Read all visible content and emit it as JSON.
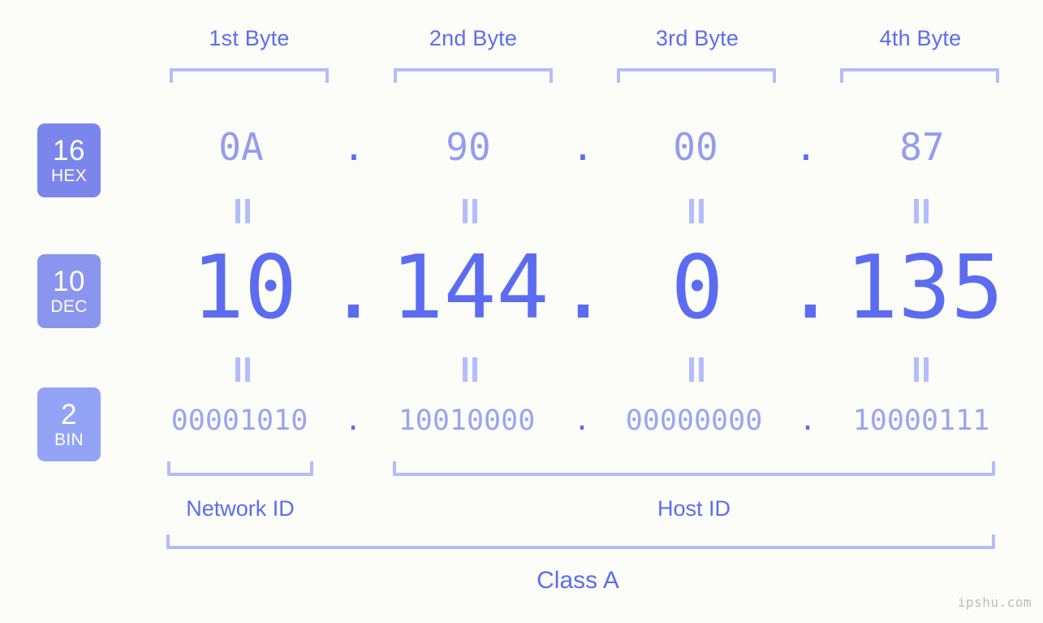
{
  "background_color": "#fcfdf9",
  "accent_color": "#5c6cf0",
  "accent_light": "#929dee",
  "bracket_color": "#b3bdfb",
  "headers": [
    {
      "label": "1st Byte"
    },
    {
      "label": "2nd Byte"
    },
    {
      "label": "3rd Byte"
    },
    {
      "label": "4th Byte"
    }
  ],
  "bases": [
    {
      "num": "16",
      "label": "HEX",
      "color": "#7b86ec"
    },
    {
      "num": "10",
      "label": "DEC",
      "color": "#8a96ee"
    },
    {
      "num": "2",
      "label": "BIN",
      "color": "#93a4f7"
    }
  ],
  "rows": {
    "hex": {
      "base": "16",
      "name": "HEX",
      "values": [
        "0A",
        "90",
        "00",
        "87"
      ],
      "separator": "."
    },
    "dec": {
      "base": "10",
      "name": "DEC",
      "values": [
        "10",
        "144",
        "0",
        "135"
      ],
      "separator": "."
    },
    "bin": {
      "base": "2",
      "name": "BIN",
      "values": [
        "00001010",
        "10010000",
        "00000000",
        "10000111"
      ],
      "separator": "."
    }
  },
  "equals_glyph": "=",
  "segments": [
    {
      "label": "Network ID"
    },
    {
      "label": "Host ID"
    }
  ],
  "class_label": "Class A",
  "watermark": "ipshu.com"
}
